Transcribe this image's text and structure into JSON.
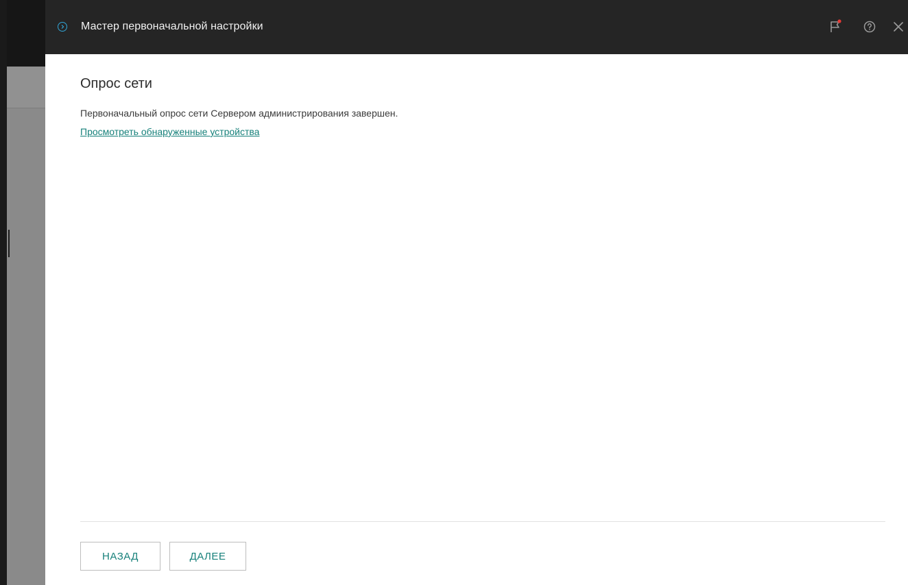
{
  "dialog": {
    "title": "Мастер первоначальной настройки",
    "icons": {
      "header_step": "chevron-circle-icon",
      "flag": "flag-icon",
      "help": "help-icon",
      "close": "close-icon"
    },
    "notification_color": "#e53935",
    "accent_color": "#16807a",
    "header_icon_color": "#32a6d8"
  },
  "step": {
    "title": "Опрос сети",
    "description": "Первоначальный опрос сети Сервером администрирования завершен.",
    "link_label": "Просмотреть обнаруженные устройства"
  },
  "footer": {
    "back_label": "НАЗАД",
    "next_label": "ДАЛЕЕ"
  }
}
